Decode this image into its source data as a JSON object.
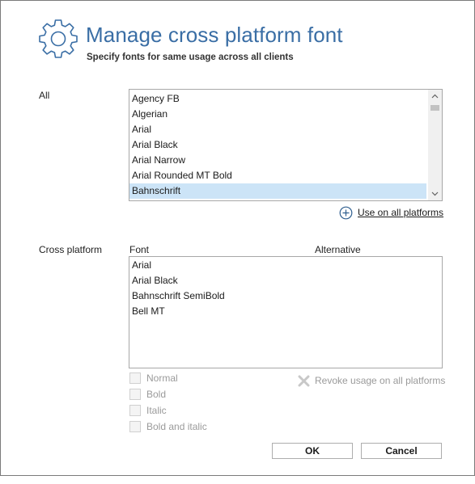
{
  "header": {
    "icon": "gear-icon",
    "title": "Manage cross platform font",
    "subtitle": "Specify fonts for same usage across all clients"
  },
  "all_section": {
    "label": "All",
    "fonts": [
      "Agency FB",
      "Algerian",
      "Arial",
      "Arial Black",
      "Arial Narrow",
      "Arial Rounded MT Bold",
      "Bahnschrift"
    ],
    "selected": "Bahnschrift",
    "use_all_label": "Use on all platforms",
    "use_all_icon": "plus-circle-icon"
  },
  "cross_section": {
    "label": "Cross platform",
    "columns": {
      "font": "Font",
      "alternative": "Alternative"
    },
    "rows": [
      "Arial",
      "Arial Black",
      "Bahnschrift SemiBold",
      "Bell MT"
    ]
  },
  "styles": {
    "normal": "Normal",
    "bold": "Bold",
    "italic": "Italic",
    "bold_italic": "Bold and italic"
  },
  "revoke": {
    "label": "Revoke usage on all platforms",
    "icon": "x-icon"
  },
  "buttons": {
    "ok": "OK",
    "cancel": "Cancel"
  },
  "colors": {
    "accent": "#3a6ea5",
    "selection": "#cce4f7",
    "disabled_text": "#9a9a9a"
  }
}
